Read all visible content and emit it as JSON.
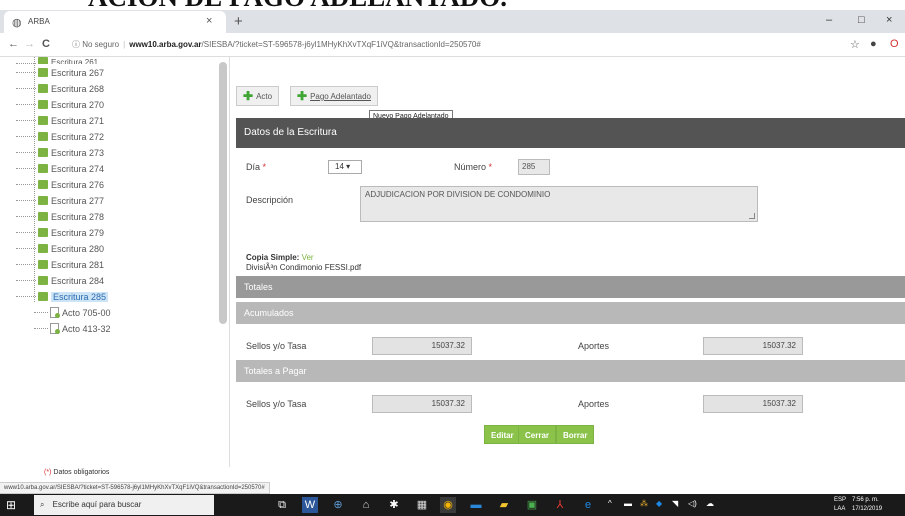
{
  "heading": "ACION DE PAGO ADELANTADO.",
  "browser": {
    "tab_title": "ARBA",
    "tab_close": "×",
    "new_tab": "+",
    "back": "←",
    "forward": "→",
    "reload": "C",
    "security": "ⓘ No seguro",
    "url_host": "www10.arba.gov.ar",
    "url_path": "/SIESBA/?ticket=ST-596578-j6yl1MHyKhXvTXqF1iVQ&transactionId=250570#",
    "win_min": "–",
    "win_max": "□",
    "win_close": "×"
  },
  "tree": {
    "items": [
      {
        "label": "Escritura 267"
      },
      {
        "label": "Escritura 268"
      },
      {
        "label": "Escritura 270"
      },
      {
        "label": "Escritura 271"
      },
      {
        "label": "Escritura 272"
      },
      {
        "label": "Escritura 273"
      },
      {
        "label": "Escritura 274"
      },
      {
        "label": "Escritura 276"
      },
      {
        "label": "Escritura 277"
      },
      {
        "label": "Escritura 278"
      },
      {
        "label": "Escritura 279"
      },
      {
        "label": "Escritura 280"
      },
      {
        "label": "Escritura 281"
      },
      {
        "label": "Escritura 284"
      },
      {
        "label": "Escritura 285"
      }
    ],
    "children": [
      {
        "label": "Acto 705-00"
      },
      {
        "label": "Acto 413-32"
      }
    ]
  },
  "toolbar": {
    "acto_label": "Acto",
    "pago_label": "Pago Adelantado",
    "tooltip": "Nuevo Pago Adelantado"
  },
  "form": {
    "section_title": "Datos de la Escritura",
    "dia_label": "Día",
    "required_mark": "*",
    "dia_value": "14 ▾",
    "numero_label": "Número",
    "numero_value": "285",
    "descripcion_label": "Descripción",
    "descripcion_value": "ADJUDICACION POR DIVISION DE CONDOMINIO",
    "copia_label": "Copia Simple:",
    "copia_link": "Ver",
    "copia_file": "DivisiÃ³n Condimonio FESSI.pdf"
  },
  "totales": {
    "title": "Totales",
    "acumulados": "Acumulados",
    "sellos_label": "Sellos y/o Tasa",
    "sellos_value": "15037.32",
    "aportes_label": "Aportes",
    "aportes_value": "15037.32",
    "a_pagar": "Totales a Pagar",
    "sellos2_label": "Sellos y/o Tasa",
    "sellos2_value": "15037.32",
    "aportes2_label": "Aportes",
    "aportes2_value": "15037.32"
  },
  "actions": {
    "editar": "Editar",
    "cerrar": "Cerrar",
    "borrar": "Borrar"
  },
  "footnote": "Datos obligatorios",
  "footnote_mark": "(*)",
  "statusbar": "www10.arba.gov.ar/SIESBA/?ticket=ST-596578-j6yl1MHyKhXvTXqF1iVQ&transactionId=250570#",
  "taskbar": {
    "search_placeholder": "Escribe aquí para buscar",
    "lang_top": "ESP",
    "lang_bottom": "LAA",
    "time": "7:56 p. m.",
    "date": "17/12/2019"
  },
  "colors": {
    "accent_green": "#8bc34a",
    "section_dark": "#545454",
    "required_red": "#d32f2f"
  }
}
